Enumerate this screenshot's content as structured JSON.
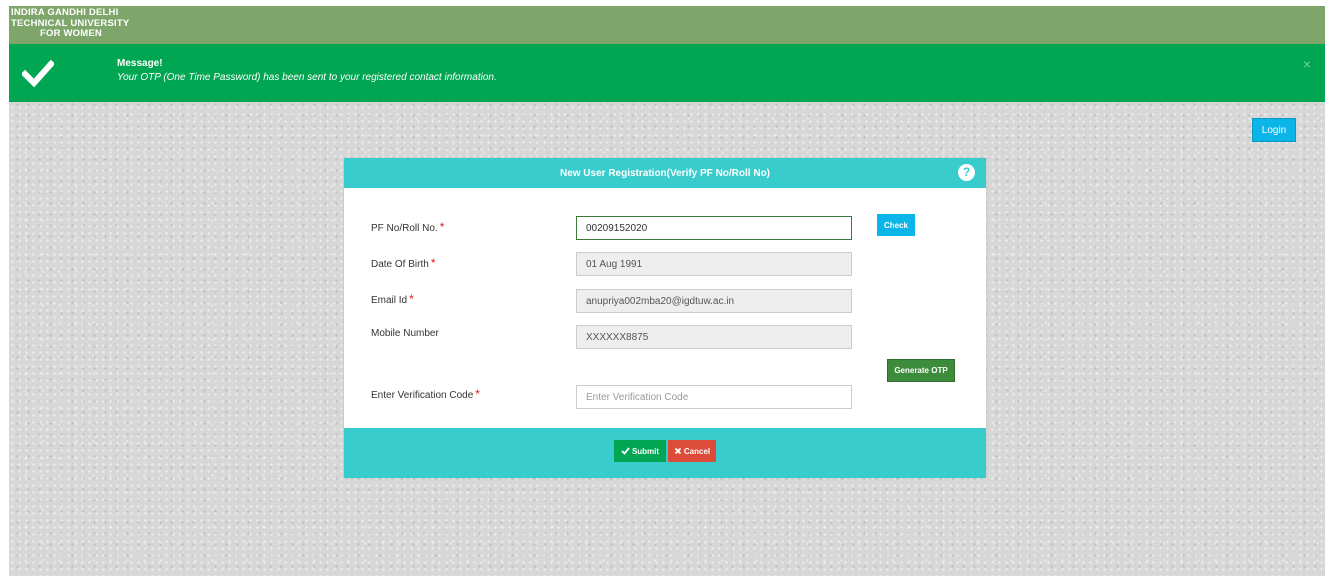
{
  "brand": {
    "line1": "INDIRA GANDHI DELHI",
    "line2": "TECHNICAL UNIVERSITY",
    "line3": "FOR WOMEN"
  },
  "alert": {
    "title": "Message!",
    "text": "Your OTP (One Time Password) has been sent to your registered contact information.",
    "close": "×",
    "icon": "checkmark-icon"
  },
  "header": {
    "login_label": "Login"
  },
  "form": {
    "title": "New User Registration(Verify PF No/Roll No)",
    "help": "?",
    "fields": [
      {
        "label": "PF No/Roll No.",
        "required": "*",
        "value": "00209152020"
      },
      {
        "label": "Date Of Birth",
        "required": "*",
        "value": "01 Aug 1991"
      },
      {
        "label": "Email Id",
        "required": "*",
        "value": "anupriya002mba20@igdtuw.ac.in"
      },
      {
        "label": "Mobile Number",
        "required": "",
        "value": "XXXXXX8875"
      },
      {
        "label": "Enter Verification Code",
        "required": "*",
        "value": "",
        "placeholder": "Enter Verification Code"
      }
    ],
    "check_label": "Check",
    "generate_otp_label": "Generate OTP",
    "submit_label": "Submit",
    "cancel_label": "Cancel"
  },
  "colors": {
    "brand_bar": "#7ea66a",
    "alert_bg": "#00a651",
    "panel_accent": "#39cccc",
    "login_btn": "#0cb5e8",
    "otp_btn": "#3c8c3c",
    "submit_btn": "#00a651",
    "cancel_btn": "#dd4b39"
  }
}
